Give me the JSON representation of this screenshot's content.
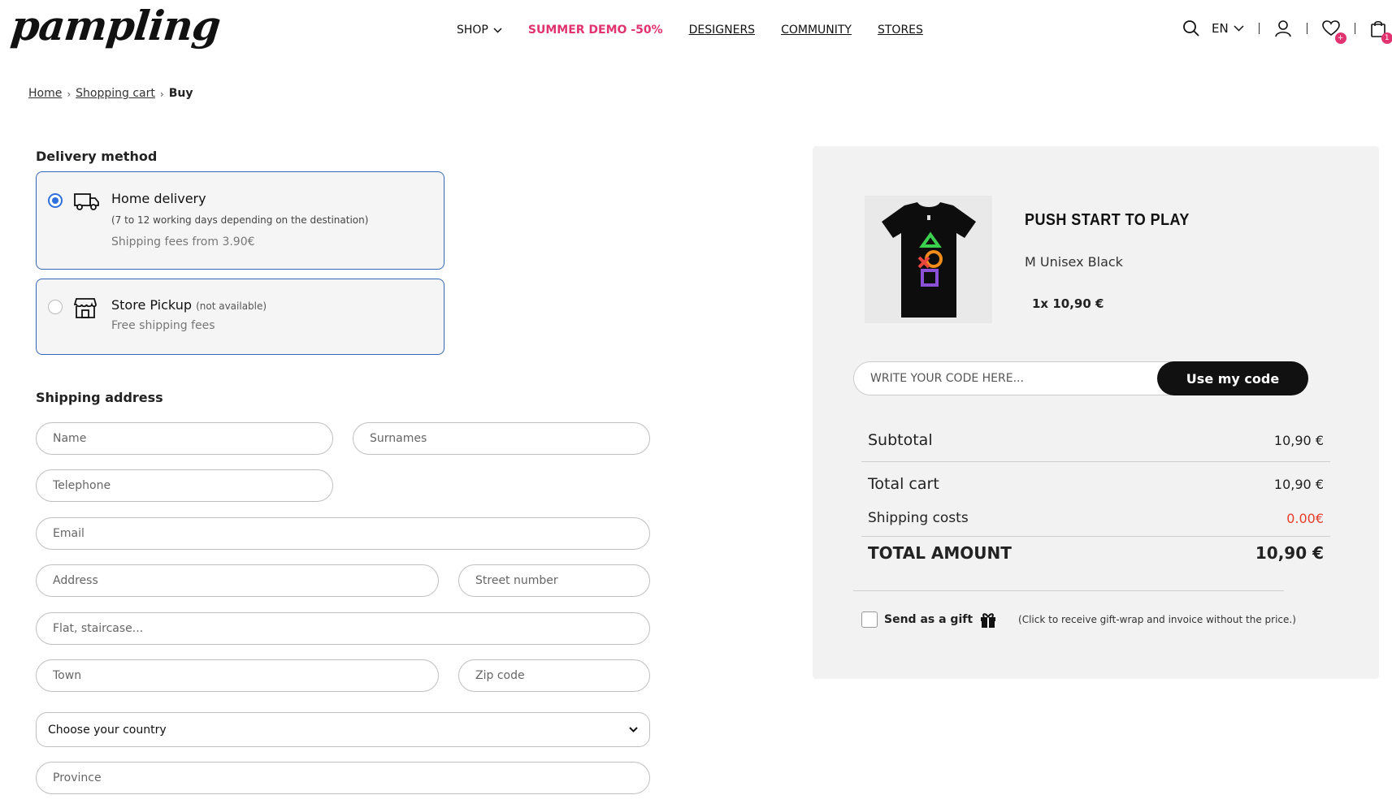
{
  "header": {
    "logo": "pampling",
    "nav": [
      {
        "label": "SHOP"
      },
      {
        "label": "SUMMER DEMO -50%"
      },
      {
        "label": "DESIGNERS"
      },
      {
        "label": "COMMUNITY"
      },
      {
        "label": "STORES"
      }
    ],
    "language": "EN",
    "wishlist_badge": "+",
    "cart_badge": "1"
  },
  "breadcrumb": [
    {
      "label": "Home"
    },
    {
      "label": "Shopping cart"
    },
    {
      "label": "Buy"
    }
  ],
  "delivery": {
    "title": "Delivery method",
    "options": [
      {
        "title": "Home delivery",
        "subtitle": "(7 to 12 working days depending on the destination)",
        "fee": "Shipping fees from 3.90€",
        "selected": true,
        "icon": "truck-icon"
      },
      {
        "title": "Store Pickup",
        "note": "(not available)",
        "fee": "Free shipping fees",
        "selected": false,
        "icon": "store-icon"
      }
    ]
  },
  "shipping": {
    "title": "Shipping address",
    "placeholders": {
      "name": "Name",
      "surnames": "Surnames",
      "telephone": "Telephone",
      "email": "Email",
      "address": "Address",
      "street_number": "Street number",
      "flat": "Flat, staircase...",
      "town": "Town",
      "zip": "Zip code",
      "province": "Province"
    },
    "country_select": "Choose your country"
  },
  "order": {
    "product_name": "PUSH START TO PLAY",
    "variant": "M Unisex Black",
    "quantity_price": "1x 10,90 €",
    "promo_placeholder": "WRITE YOUR CODE HERE...",
    "promo_button": "Use my code",
    "subtotal_label": "Subtotal",
    "subtotal_value": "10,90 €",
    "total_cart_label": "Total cart",
    "total_cart_value": "10,90 €",
    "shipping_label": "Shipping costs",
    "shipping_value": "0.00€",
    "total_label": "TOTAL AMOUNT",
    "total_value": "10,90 €",
    "gift_label": "Send as a gift",
    "gift_note": "(Click to receive gift-wrap and invoice without the price.)"
  },
  "colors": {
    "accent": "#e0336f",
    "radio_blue": "#2f6fde",
    "card_border": "#3567b8",
    "shipping_red": "#e53e2a"
  }
}
